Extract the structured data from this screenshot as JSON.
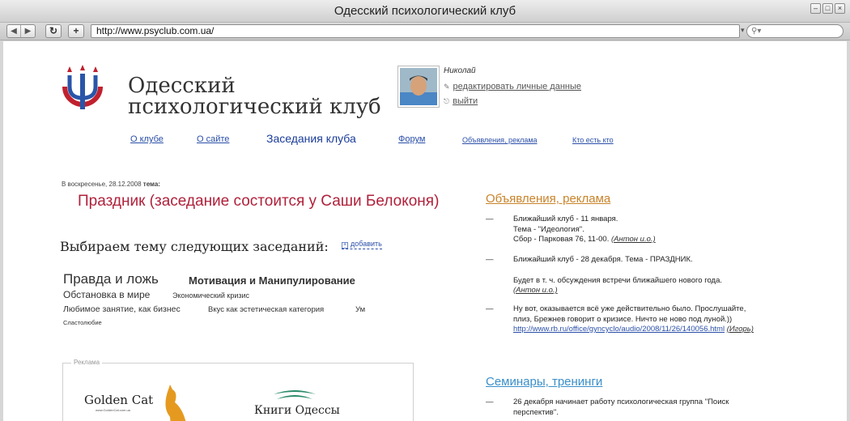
{
  "window": {
    "title": "Одесский психологический клуб",
    "url": "http://www.psyclub.com.ua/",
    "search_icon": "magnifier-icon"
  },
  "site": {
    "name_line1": "Одесский",
    "name_line2": "психологический клуб"
  },
  "user": {
    "name": "Николай",
    "edit_link": "редактировать личные данные",
    "logout_link": "выйти"
  },
  "nav": [
    {
      "label": "О клубе"
    },
    {
      "label": "О сайте"
    },
    {
      "label": "Заседания клуба"
    },
    {
      "label": "Форум"
    },
    {
      "label": "Объявления, реклама"
    },
    {
      "label": "Кто есть кто"
    }
  ],
  "meeting": {
    "date": "В воскресенье, 28.12.2008",
    "label": "тема:",
    "title": "Праздник (заседание состоится у Саши Белоконя)"
  },
  "topics": {
    "heading": "Выбираем тему следующих заседаний:",
    "add_label": "добавить",
    "tags": [
      "Правда и ложь",
      "Мотивация и Манипулирование",
      "Обстановка в мире",
      "Экономический кризис",
      "Любимое занятие, как бизнес",
      "Вкус как эстетическая категория",
      "Ум",
      "Сластолюбие"
    ]
  },
  "ads": {
    "label": "Реклама",
    "golden_cat": "Golden Cat",
    "golden_cat_url": "www.GoldenCat.com.ua",
    "books": "Книги Одессы"
  },
  "announcements": {
    "title": "Объявления, реклама",
    "dash": "—",
    "items": [
      {
        "line1": "Ближайший клуб - 11 января.",
        "line2": "Тема - \"Идеология\".",
        "line3": "Сбор - Парковая 76, 11-00.",
        "author": "(Антон и.о.)"
      },
      {
        "line1": "Ближайший клуб - 28 декабря. Тема - ПРАЗДНИК.",
        "line2": "Будет в т. ч. обсуждения встречи ближайшего нового года.",
        "author": "(Антон и.о.)"
      },
      {
        "line1": "Ну вот, оказывается всё уже действительно было. Прослушайте,",
        "line2": "плиз, Брежнев говорит о кризисе. Ничто не ново под луной.))",
        "link": "http://www.rb.ru/office/gyncyclo/audio/2008/11/26/140056.html",
        "author": "(Игорь)"
      }
    ]
  },
  "seminars": {
    "title": "Семинары, тренинги",
    "item_line1": "26 декабря начинает работу психологическая группа \"Поиск",
    "item_line2": "перспектив\"."
  },
  "colors": {
    "meeting_title": "#b0213b",
    "announcements_title": "#c8832a",
    "seminars_title": "#3a8fc8",
    "link": "#2a4fa8"
  }
}
